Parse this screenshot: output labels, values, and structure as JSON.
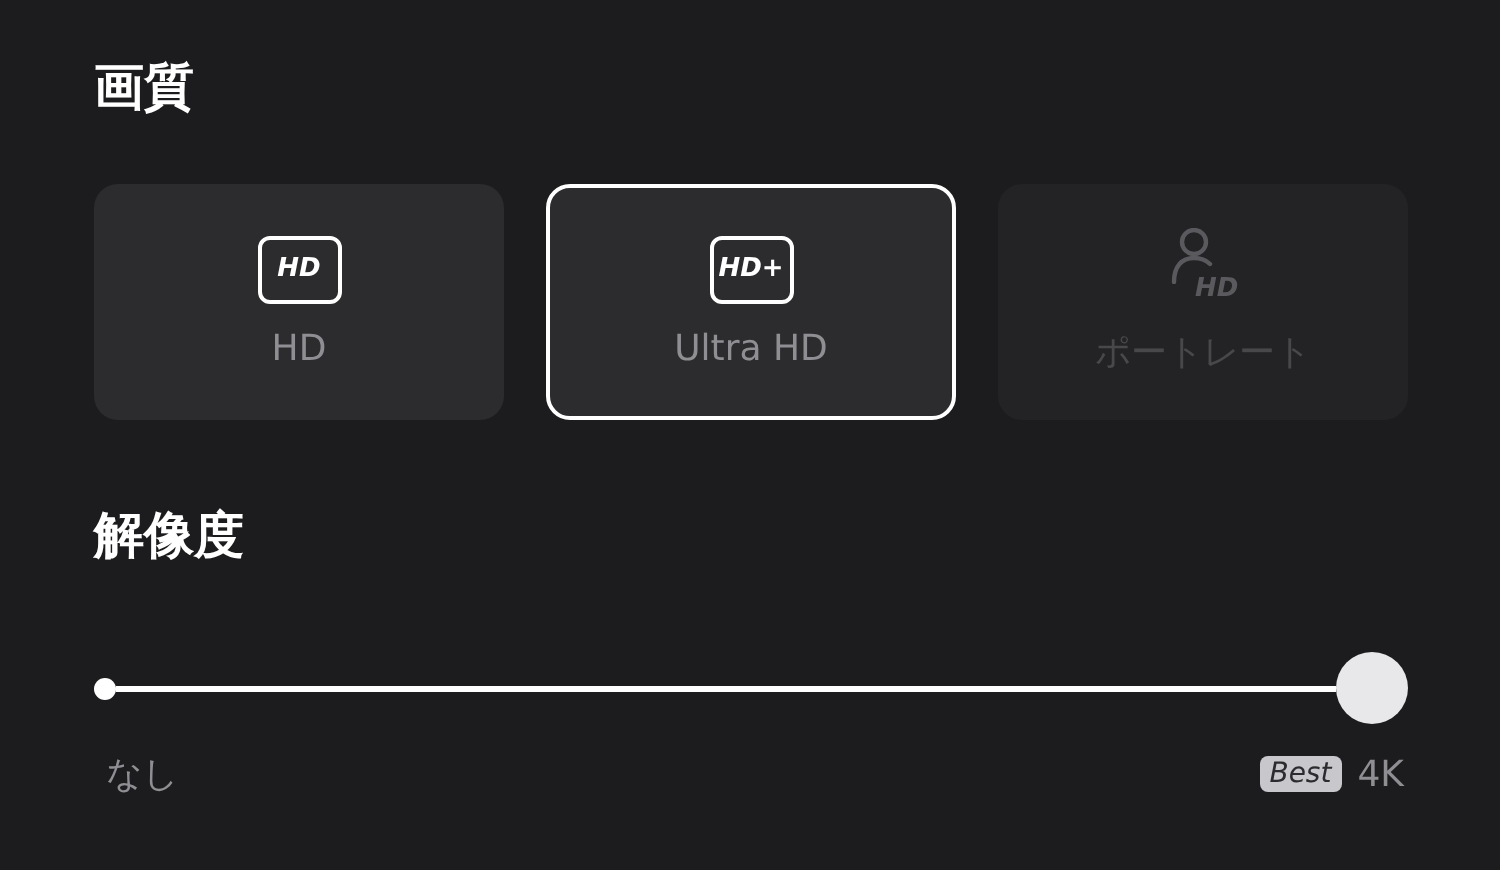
{
  "quality": {
    "title": "画質",
    "options": [
      {
        "kind": "badge",
        "icon_text": "HD",
        "label": "HD",
        "selected": false,
        "disabled": false
      },
      {
        "kind": "badge",
        "icon_text": "HD+",
        "label": "Ultra HD",
        "selected": true,
        "disabled": false
      },
      {
        "kind": "portrait",
        "icon_text": "HD",
        "label": "ポートレート",
        "selected": false,
        "disabled": true
      }
    ]
  },
  "resolution": {
    "title": "解像度",
    "level": 1,
    "min_label": "なし",
    "best_badge": "Best",
    "max_label": "4K"
  }
}
